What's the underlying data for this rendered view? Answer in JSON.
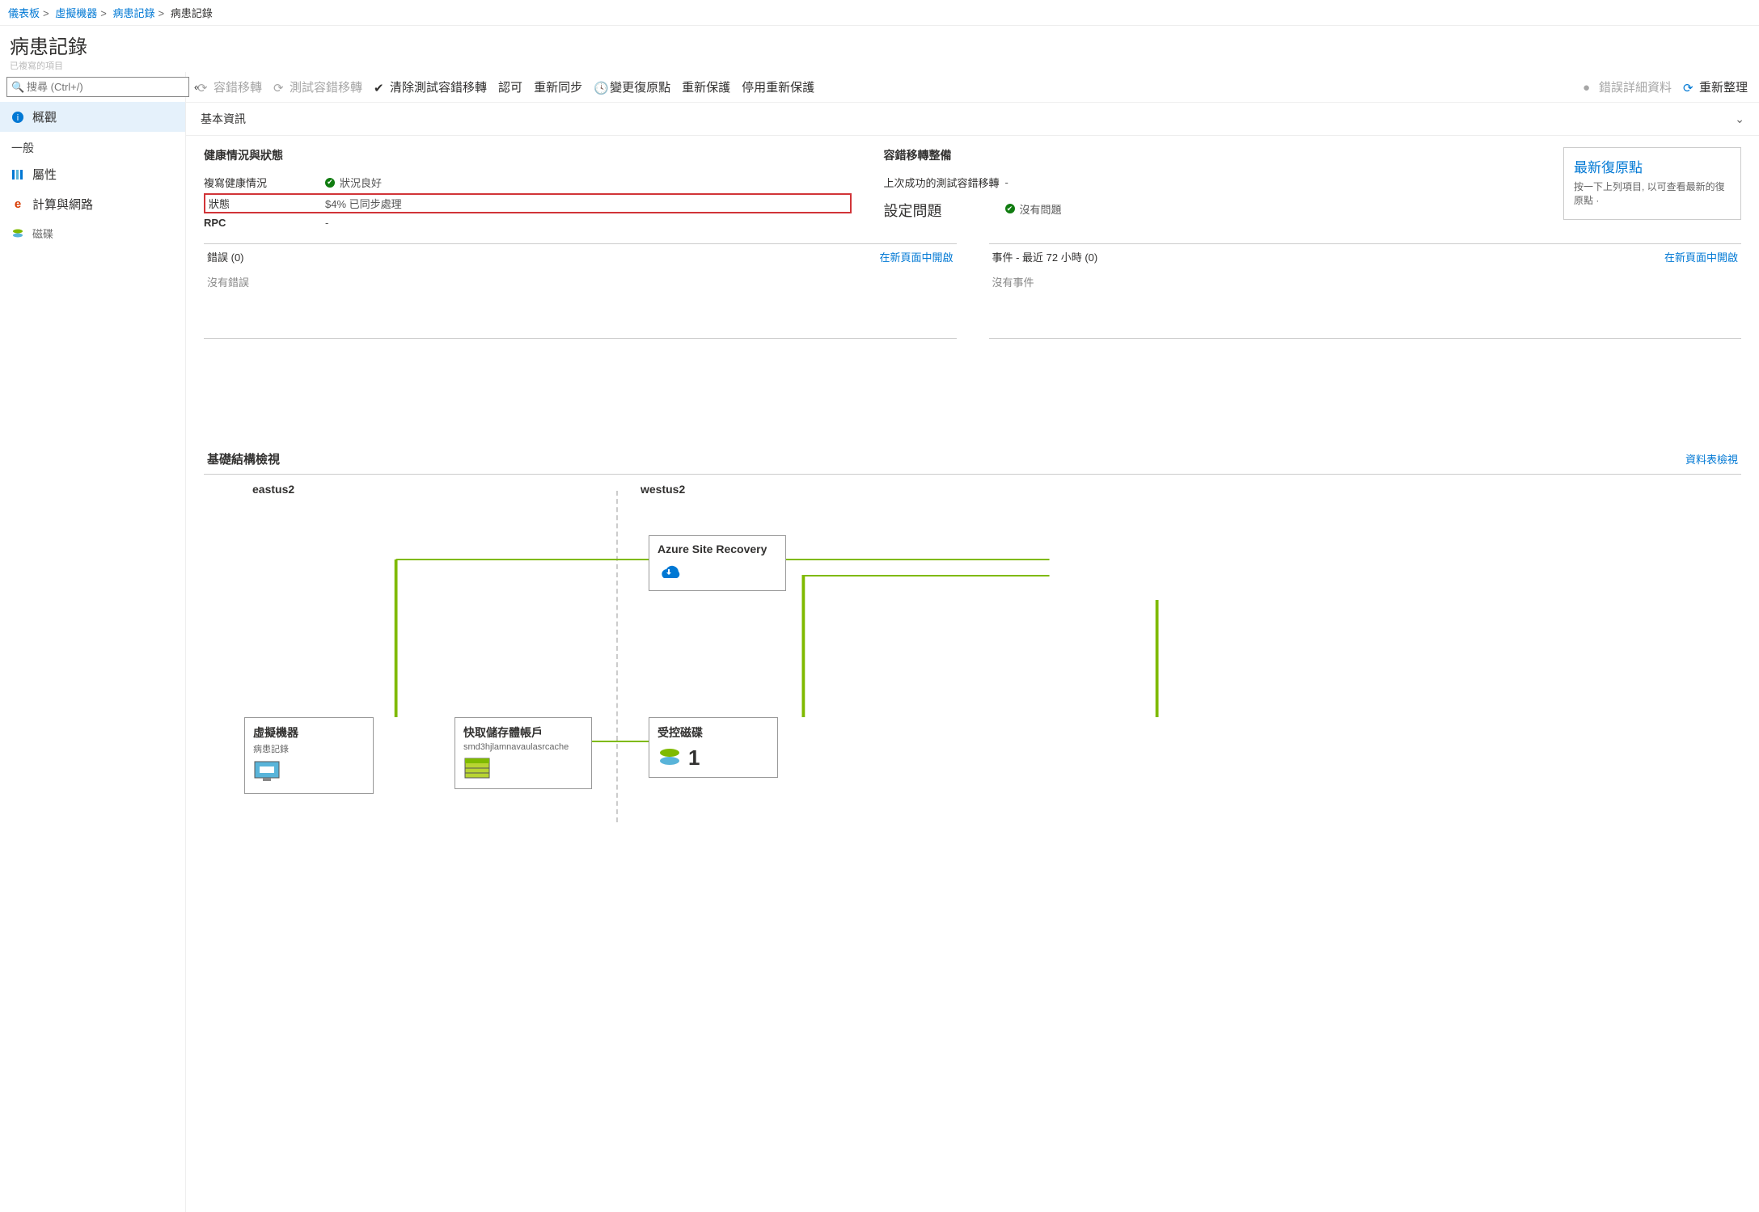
{
  "breadcrumb": {
    "items": [
      "儀表板",
      "虛擬機器",
      "病患記錄"
    ],
    "current": "病患記錄"
  },
  "page": {
    "title": "病患記錄",
    "editedLabel": "已複寫的項目"
  },
  "search": {
    "placeholder": "搜尋 (Ctrl+/)"
  },
  "sidebar": {
    "items": [
      {
        "label": "概觀"
      },
      {
        "label": "一般",
        "section": true
      },
      {
        "label": "屬性"
      },
      {
        "label": "計算與網路"
      },
      {
        "label": "磁碟"
      }
    ]
  },
  "toolbar": {
    "failover": "容錯移轉",
    "testFailover": "測試容錯移轉",
    "cleanupTest": "清除測試容錯移轉",
    "commit": "認可",
    "resync": "重新同步",
    "changeRecovery": "變更復原點",
    "reprotect": "重新保護",
    "disableReprotect": "停用重新保護",
    "errorDetails": "錯誤詳細資料",
    "refresh": "重新整理"
  },
  "essentials": {
    "title": "基本資訊"
  },
  "health": {
    "heading": "健康情況與狀態",
    "replHealthLabel": "複寫健康情況",
    "replHealthValue": "狀況良好",
    "statusLabel": "狀態",
    "statusValue": "$4% 已同步處理",
    "rpcLabel": "RPC",
    "rpcValue": "-"
  },
  "failoverReady": {
    "heading": "容錯移轉整備",
    "lastTestLabel": "上次成功的測試容錯移轉",
    "lastTestValue": "-",
    "configLabel": "設定問題",
    "configValue": "沒有問題"
  },
  "recovery": {
    "title": "最新復原點",
    "sub": "按一下上列項目, 以可查看最新的復原點 ·"
  },
  "errorsPane": {
    "title": "錯誤 (0)",
    "open": "在新頁面中開啟",
    "empty": "沒有錯誤"
  },
  "eventsPane": {
    "title": "事件 - 最近 72 小時 (0)",
    "open": "在新頁面中開啟",
    "empty": "沒有事件"
  },
  "infra": {
    "title": "基礎結構檢視",
    "tableView": "資料表檢視",
    "left": "eastus2",
    "right": "westus2",
    "asr": "Azure Site Recovery",
    "vm": {
      "title": "虛擬機器",
      "sub": "病患記錄"
    },
    "cache": {
      "title": "快取儲存體帳戶",
      "sub": "smd3hjlamnavaulasrcache"
    },
    "disk": {
      "title": "受控磁碟",
      "count": "1"
    }
  }
}
